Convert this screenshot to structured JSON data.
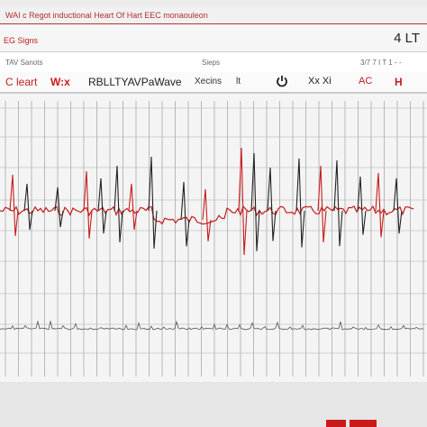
{
  "window": {
    "title": "WAI  c  Regot inductional Heart Of Hart EEC monaouleon"
  },
  "header": {
    "left_label": "EG Signs",
    "right_label": "4 LT"
  },
  "subheader": {
    "left": "TAV Sanots",
    "center": "Sieps",
    "right": "3/7 7 I T  1 -  -"
  },
  "toolbar": {
    "heart_label": "C leart",
    "wx_label": "W:x",
    "wave_label": "RBLLTYAVPaWave",
    "secs_label": "Xecins",
    "it_label": "lt",
    "power_icon": "power-icon",
    "xx_label": "Xx Xi",
    "ac_label": "AC",
    "h_label": "H"
  },
  "colors": {
    "accent": "#c81a1a",
    "signal_dark": "#222222",
    "grid": "#8f8f8f"
  }
}
